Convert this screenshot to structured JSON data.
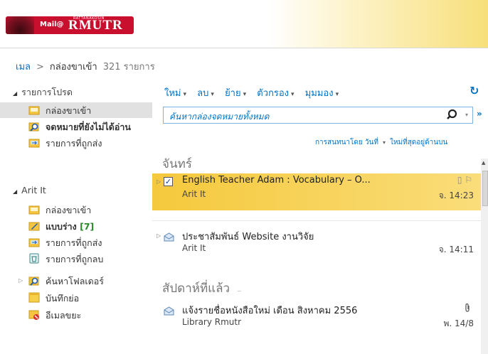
{
  "brand": {
    "mail_label": "Mail@",
    "name": "RMUTR",
    "tagline": "RATTANAKOSIN"
  },
  "breadcrumb": {
    "root": "เมล",
    "separator": ">",
    "current": "กล่องขาเข้า",
    "count": "321 รายการ"
  },
  "sidebar": {
    "favorites_label": "รายการโปรด",
    "favorites": [
      {
        "label": "กล่องขาเข้า",
        "icon": "inbox-icon",
        "selected": true
      },
      {
        "label": "จดหมายที่ยังไม่ได้อ่าน",
        "icon": "search-folder-icon",
        "bold": true
      },
      {
        "label": "รายการที่ถูกส่ง",
        "icon": "sent-items-icon"
      }
    ],
    "account_label": "Arit It",
    "account_folders": [
      {
        "label": "กล่องขาเข้า",
        "icon": "inbox-icon"
      },
      {
        "label": "แบบร่าง",
        "count": "[7]",
        "icon": "drafts-icon",
        "bold": true
      },
      {
        "label": "รายการที่ถูกส่ง",
        "icon": "sent-items-icon"
      },
      {
        "label": "รายการที่ถูกลบ",
        "icon": "deleted-items-icon"
      },
      {
        "label": "ค้นหาโฟลเดอร์",
        "icon": "search-folder-icon"
      },
      {
        "label": "บันทึกย่อ",
        "icon": "notes-icon"
      },
      {
        "label": "อีเมลขยะ",
        "icon": "junk-icon"
      }
    ]
  },
  "toolbar": {
    "new": "ใหม่",
    "delete": "ลบ",
    "move": "ย้าย",
    "filter": "ตัวกรอง",
    "view": "มุมมอง"
  },
  "search": {
    "placeholder": "ค้นหากล่องจดหมายทั้งหมด"
  },
  "sort": {
    "by": "การสนทนาโดย วันที่",
    "order": "ใหม่ที่สุดอยู่ด้านบน"
  },
  "groups": [
    {
      "label": "จันทร์",
      "messages": [
        {
          "subject": "English Teacher Adam : Vocabulary – O...",
          "from": "Arit It",
          "time": "จ. 14:23",
          "selected": true,
          "checked": true
        },
        {
          "subject": "ประชาสัมพันธ์ Website งานวิจัย",
          "from": "Arit It",
          "time": "จ. 14:11"
        }
      ]
    },
    {
      "label": "สัปดาห์ที่แล้ว",
      "messages": [
        {
          "subject": "แจ้งรายชื่อหนังสือใหม่ เดือน สิงหาคม 2556",
          "from": "Library Rmutr",
          "time": "พ. 14/8",
          "attachment": true
        }
      ]
    }
  ],
  "colors": {
    "accent": "#0072c6",
    "selection": "#f5c93c",
    "brand": "#c8102e"
  }
}
